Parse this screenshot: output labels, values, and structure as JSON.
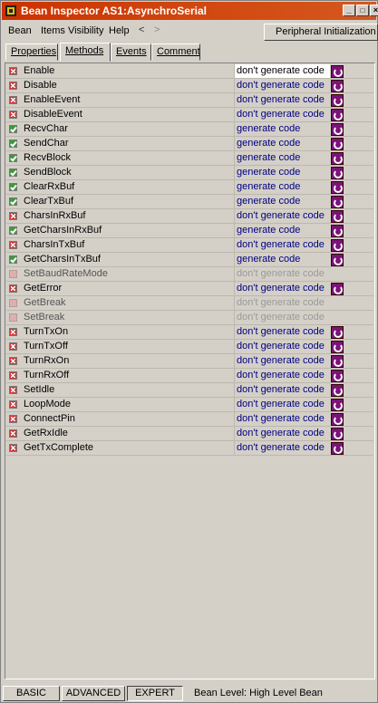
{
  "window": {
    "title": "Bean Inspector AS1:AsynchroSerial",
    "controls": [
      "_",
      "□",
      "×"
    ]
  },
  "menu": {
    "items": [
      "Bean",
      "Items Visibility",
      "Help"
    ],
    "nav_left": "<",
    "nav_right": ">",
    "peripheral_button": "Peripheral Initialization >"
  },
  "tabs": [
    "Properties",
    "Methods",
    "Events",
    "Comment"
  ],
  "active_tab": "Methods",
  "methods": [
    {
      "name": "Enable",
      "value": "don't generate code",
      "state": "on",
      "selected": true,
      "enabled": true
    },
    {
      "name": "Disable",
      "value": "don't generate code",
      "state": "on",
      "enabled": true
    },
    {
      "name": "EnableEvent",
      "value": "don't generate code",
      "state": "on",
      "enabled": true
    },
    {
      "name": "DisableEvent",
      "value": "don't generate code",
      "state": "on",
      "enabled": true
    },
    {
      "name": "RecvChar",
      "value": "generate code",
      "state": "gen",
      "enabled": true
    },
    {
      "name": "SendChar",
      "value": "generate code",
      "state": "gen",
      "enabled": true
    },
    {
      "name": "RecvBlock",
      "value": "generate code",
      "state": "gen",
      "enabled": true
    },
    {
      "name": "SendBlock",
      "value": "generate code",
      "state": "gen",
      "enabled": true
    },
    {
      "name": "ClearRxBuf",
      "value": "generate code",
      "state": "gen",
      "enabled": true
    },
    {
      "name": "ClearTxBuf",
      "value": "generate code",
      "state": "gen",
      "enabled": true
    },
    {
      "name": "CharsInRxBuf",
      "value": "don't generate code",
      "state": "on",
      "enabled": true
    },
    {
      "name": "GetCharsInRxBuf",
      "value": "generate code",
      "state": "gen",
      "enabled": true
    },
    {
      "name": "CharsInTxBuf",
      "value": "don't generate code",
      "state": "on",
      "enabled": true
    },
    {
      "name": "GetCharsInTxBuf",
      "value": "generate code",
      "state": "gen",
      "enabled": true
    },
    {
      "name": "SetBaudRateMode",
      "value": "don't generate code",
      "state": "dis",
      "enabled": false
    },
    {
      "name": "GetError",
      "value": "don't generate code",
      "state": "on",
      "enabled": true
    },
    {
      "name": "GetBreak",
      "value": "don't generate code",
      "state": "dis",
      "enabled": false
    },
    {
      "name": "SetBreak",
      "value": "don't generate code",
      "state": "dis",
      "enabled": false
    },
    {
      "name": "TurnTxOn",
      "value": "don't generate code",
      "state": "on",
      "enabled": true
    },
    {
      "name": "TurnTxOff",
      "value": "don't generate code",
      "state": "on",
      "enabled": true
    },
    {
      "name": "TurnRxOn",
      "value": "don't generate code",
      "state": "on",
      "enabled": true
    },
    {
      "name": "TurnRxOff",
      "value": "don't generate code",
      "state": "on",
      "enabled": true
    },
    {
      "name": "SetIdle",
      "value": "don't generate code",
      "state": "on",
      "enabled": true
    },
    {
      "name": "LoopMode",
      "value": "don't generate code",
      "state": "on",
      "enabled": true
    },
    {
      "name": "ConnectPin",
      "value": "don't generate code",
      "state": "on",
      "enabled": true
    },
    {
      "name": "GetRxIdle",
      "value": "don't generate code",
      "state": "on",
      "enabled": true
    },
    {
      "name": "GetTxComplete",
      "value": "don't generate code",
      "state": "on",
      "enabled": true
    }
  ],
  "status": {
    "buttons": [
      "BASIC",
      "ADVANCED",
      "EXPERT"
    ],
    "pressed": "EXPERT",
    "level_label": "Bean Level: High Level Bean"
  },
  "colors": {
    "title_bar": "#cc3300",
    "value_text": "#000080",
    "method_button": "#7a1478"
  }
}
